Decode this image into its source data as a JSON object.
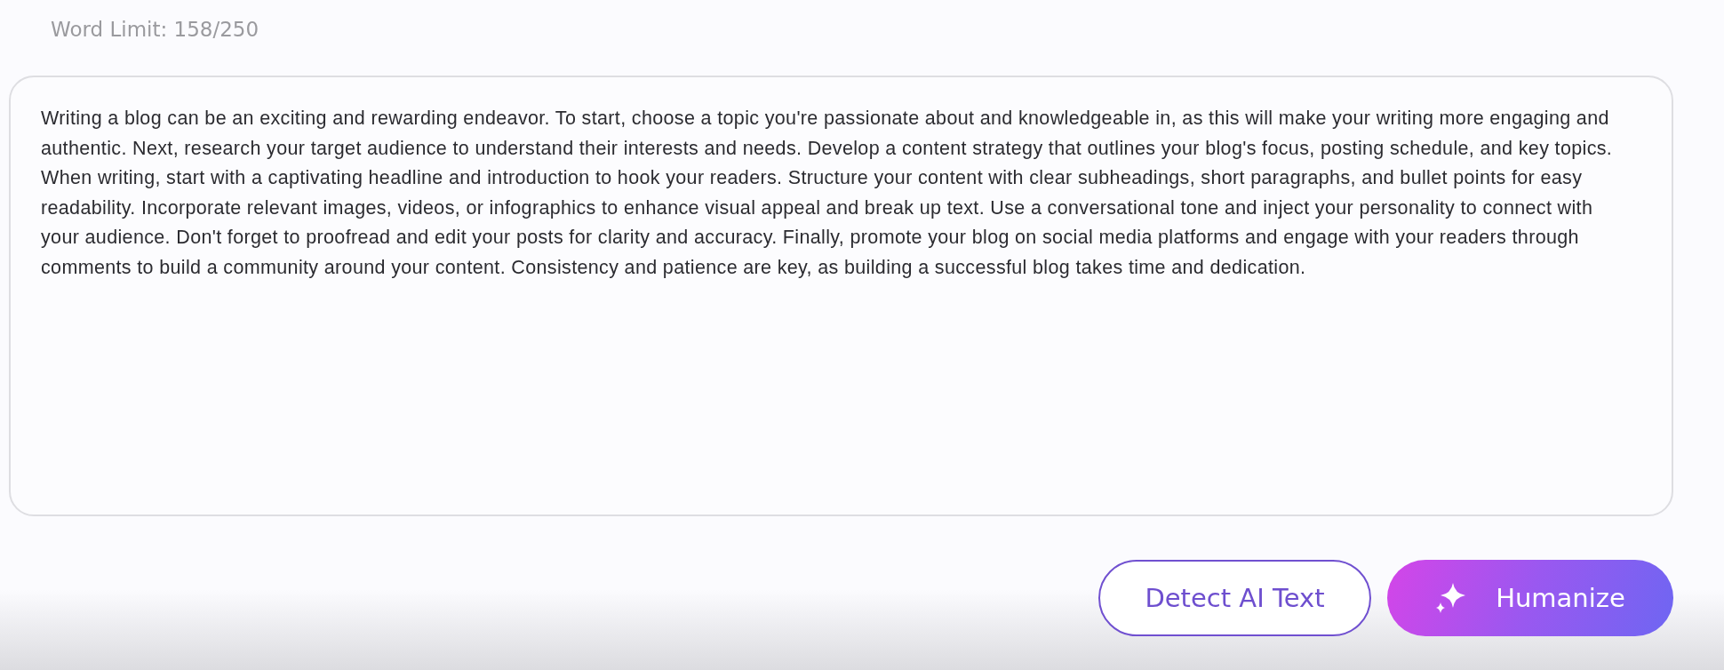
{
  "word_limit": "Word Limit: 158/250",
  "editor": {
    "value": "Writing a blog can be an exciting and rewarding endeavor. To start, choose a topic you're passionate about and knowledgeable in, as this will make your writing more engaging and authentic. Next, research your target audience to understand their interests and needs. Develop a content strategy that outlines your blog's focus, posting schedule, and key topics. When writing, start with a captivating headline and introduction to hook your readers. Structure your content with clear subheadings, short paragraphs, and bullet points for easy readability. Incorporate relevant images, videos, or infographics to enhance visual appeal and break up text. Use a conversational tone and inject your personality to connect with your audience. Don't forget to proofread and edit your posts for clarity and accuracy. Finally, promote your blog on social media platforms and engage with your readers through comments to build a community around your content. Consistency and patience are key, as building a successful blog takes time and dedication."
  },
  "buttons": [
    {
      "label": "Detect AI Text",
      "kind": "outline"
    },
    {
      "label": "Humanize",
      "kind": "primary"
    }
  ]
}
